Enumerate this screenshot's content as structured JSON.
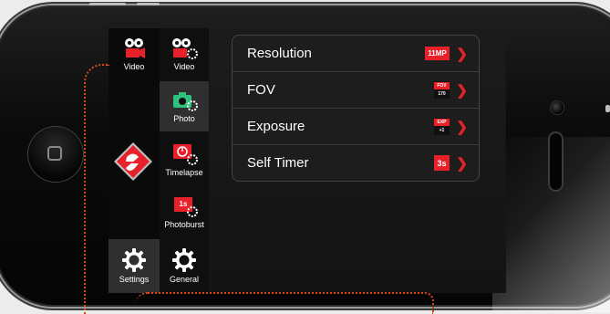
{
  "sidebar_left": {
    "video": {
      "label": "Video",
      "icon": "video-camera-icon"
    },
    "settings": {
      "label": "Settings",
      "icon": "gear-icon"
    }
  },
  "sidebar_right": {
    "video": {
      "label": "Video",
      "icon": "video-settings-icon"
    },
    "photo": {
      "label": "Photo",
      "icon": "photo-camera-icon"
    },
    "timelapse": {
      "label": "Timelapse",
      "icon": "timelapse-icon"
    },
    "photoburst": {
      "label": "Photoburst",
      "icon": "photoburst-icon",
      "badge": "1s"
    },
    "general": {
      "label": "General",
      "icon": "gear-icon"
    }
  },
  "settings_menu": {
    "resolution": {
      "label": "Resolution",
      "value": "11MP"
    },
    "fov": {
      "label": "FOV",
      "value_top": "FOV",
      "value_bottom": "170"
    },
    "exposure": {
      "label": "Exposure",
      "value_top": "EXP",
      "value_bottom": "+1"
    },
    "self_timer": {
      "label": "Self Timer",
      "value": "3s"
    }
  },
  "colors": {
    "accent": "#e8202a",
    "screen_bg": "#171717",
    "annotation": "#d64a1a"
  }
}
